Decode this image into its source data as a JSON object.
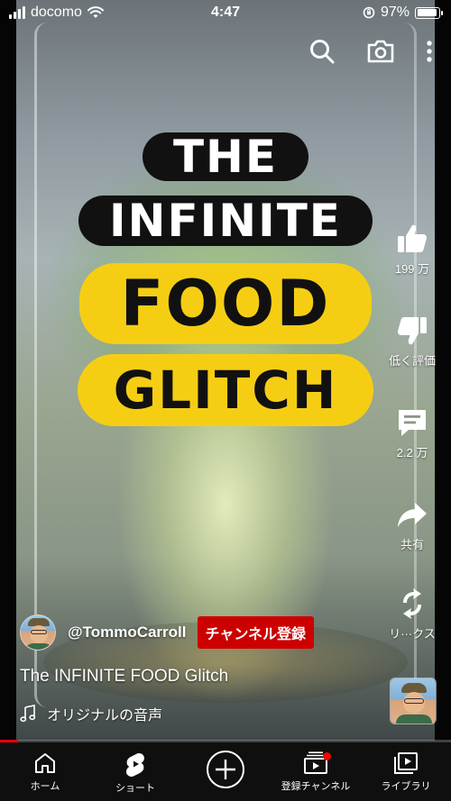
{
  "status_bar": {
    "carrier": "docomo",
    "time": "4:47",
    "battery_text": "97%",
    "battery_level": 0.97
  },
  "top_icons": [
    "search-icon",
    "camera-icon",
    "more-vert-icon"
  ],
  "overlay_title": {
    "line1": "THE",
    "line2": "INFINITE",
    "line3": "FOOD",
    "line4": "GLITCH"
  },
  "actions": {
    "like_count": "199 万",
    "dislike_label": "低く評価",
    "comment_count": "2.2 万",
    "share_label": "共有",
    "remix_label": "リ···クス"
  },
  "channel": {
    "handle": "@TommoCarroll",
    "subscribe_label": "チャンネル登録"
  },
  "video_title": "The INFINITE FOOD Glitch",
  "sound_label": "オリジナルの音声",
  "progress": 0.04,
  "bottom_nav": {
    "home": "ホーム",
    "shorts": "ショート",
    "subscriptions": "登録チャンネル",
    "library": "ライブラリ"
  },
  "colors": {
    "accent_red": "#cc0000",
    "title_yellow": "#f5ce14",
    "title_black": "#111111",
    "nav_bg": "#0f0f0f"
  }
}
